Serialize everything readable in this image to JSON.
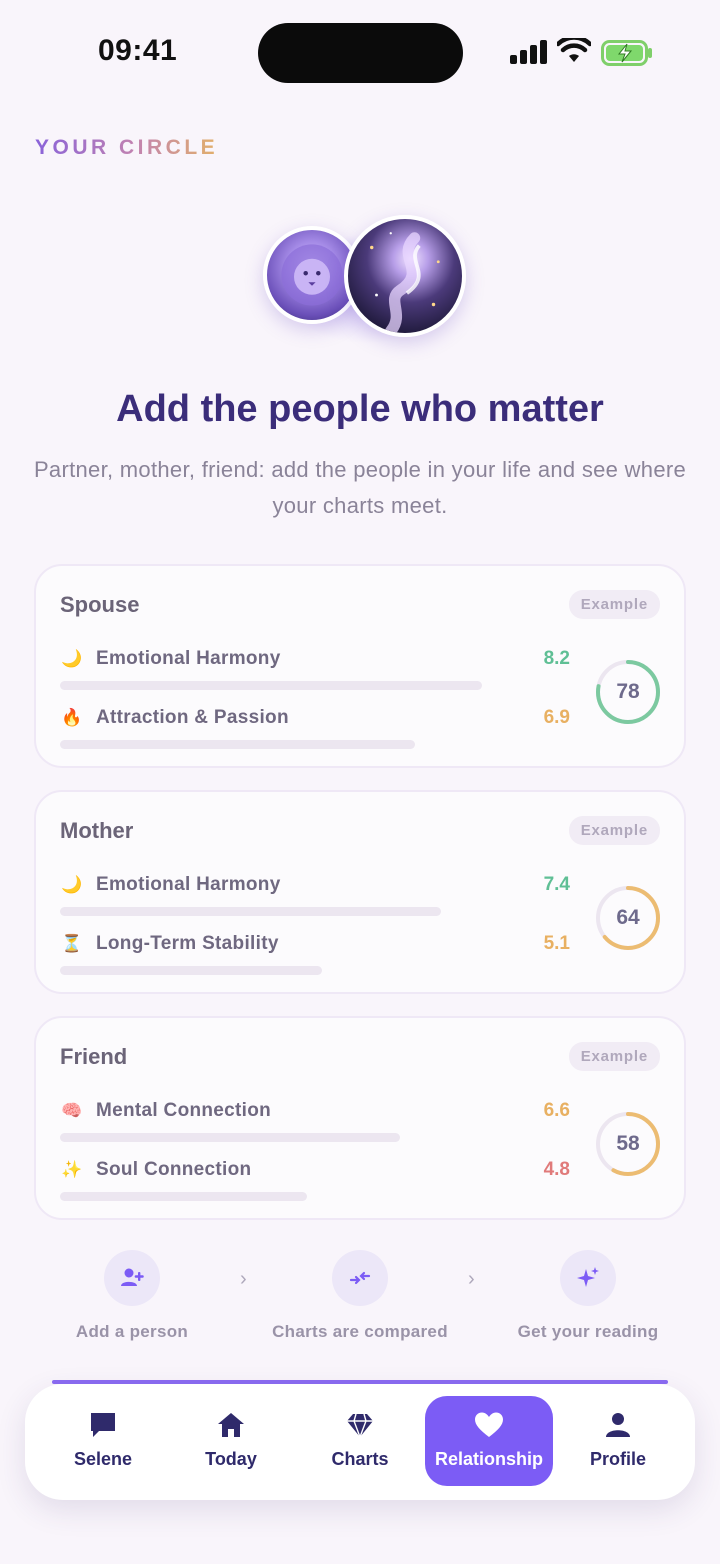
{
  "status": {
    "time": "09:41"
  },
  "eyebrow": "YOUR CIRCLE",
  "headline": "Add the people who matter",
  "subtitle": "Partner, mother, friend: add the people in your life and see where your charts meet.",
  "cards": [
    {
      "title": "Spouse",
      "badge": "Example",
      "score": 78,
      "score_fraction": 0.78,
      "score_color": "#7cc9a0",
      "metrics": [
        {
          "icon": "🌙",
          "icon_name": "moon-icon",
          "label": "Emotional Harmony",
          "value": "8.2",
          "color": "#5fbf95"
        },
        {
          "icon": "🔥",
          "icon_name": "fire-icon",
          "label": "Attraction & Passion",
          "value": "6.9",
          "color": "#e8b062"
        }
      ]
    },
    {
      "title": "Mother",
      "badge": "Example",
      "score": 64,
      "score_fraction": 0.64,
      "score_color": "#ecbc72",
      "metrics": [
        {
          "icon": "🌙",
          "icon_name": "moon-icon",
          "label": "Emotional Harmony",
          "value": "7.4",
          "color": "#5fbf95"
        },
        {
          "icon": "⏳",
          "icon_name": "hourglass-icon",
          "label": "Long-Term Stability",
          "value": "5.1",
          "color": "#e8b062"
        }
      ]
    },
    {
      "title": "Friend",
      "badge": "Example",
      "score": 58,
      "score_fraction": 0.58,
      "score_color": "#ecbc72",
      "metrics": [
        {
          "icon": "🧠",
          "icon_name": "brain-icon",
          "label": "Mental Connection",
          "value": "6.6",
          "color": "#e8b062"
        },
        {
          "icon": "✨",
          "icon_name": "sparkles-icon",
          "label": "Soul Connection",
          "value": "4.8",
          "color": "#e07a7a"
        }
      ]
    }
  ],
  "steps": [
    {
      "label": "Add a person",
      "icon": "add-person-icon"
    },
    {
      "label": "Charts are compared",
      "icon": "compare-arrows-icon"
    },
    {
      "label": "Get your reading",
      "icon": "sparkles-icon"
    }
  ],
  "tabs": [
    {
      "label": "Selene",
      "icon": "chat-icon",
      "active": false
    },
    {
      "label": "Today",
      "icon": "home-icon",
      "active": false
    },
    {
      "label": "Charts",
      "icon": "diamond-icon",
      "active": false
    },
    {
      "label": "Relationship",
      "icon": "heart-icon",
      "active": true
    },
    {
      "label": "Profile",
      "icon": "person-icon",
      "active": false
    }
  ],
  "colors": {
    "accent": "#7c5cf5",
    "heading": "#3b2d7a"
  }
}
